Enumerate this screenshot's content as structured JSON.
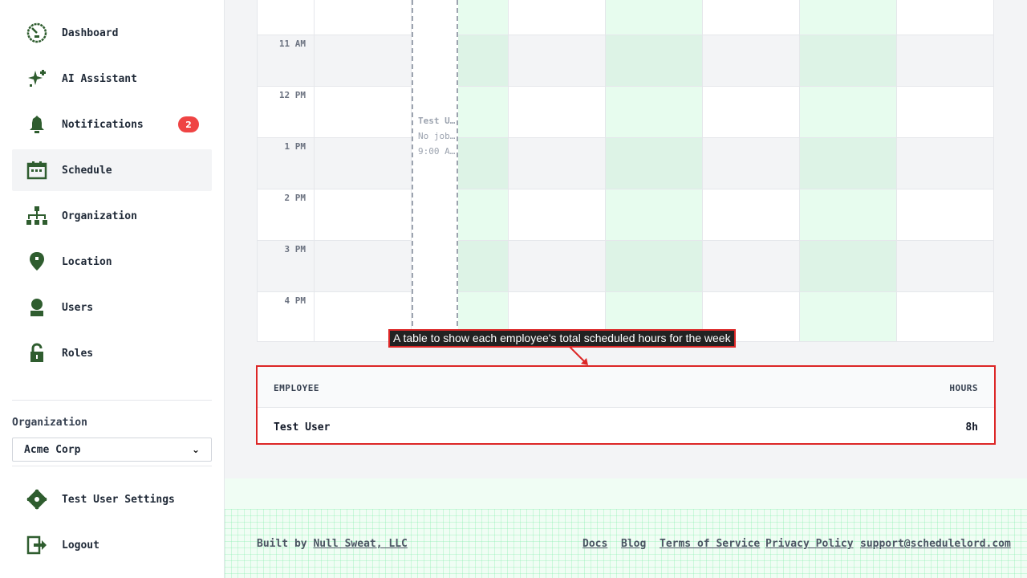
{
  "sidebar": {
    "items": [
      {
        "label": "Dashboard",
        "icon": "dashboard-icon"
      },
      {
        "label": "AI Assistant",
        "icon": "sparkle-icon"
      },
      {
        "label": "Notifications",
        "icon": "bell-icon",
        "badge": "2"
      },
      {
        "label": "Schedule",
        "icon": "calendar-icon",
        "active": true
      },
      {
        "label": "Organization",
        "icon": "org-chart-icon"
      },
      {
        "label": "Location",
        "icon": "location-pin-icon"
      },
      {
        "label": "Users",
        "icon": "user-icon"
      },
      {
        "label": "Roles",
        "icon": "lock-icon"
      }
    ],
    "organization_label": "Organization",
    "organization_selected": "Acme Corp",
    "settings_label": "Test User Settings",
    "logout_label": "Logout"
  },
  "calendar": {
    "time_labels": [
      "11 AM",
      "12 PM",
      "1 PM",
      "2 PM",
      "3 PM",
      "4 PM"
    ],
    "event": {
      "title": "Test U…",
      "subtitle": "No job…",
      "time": "9:00 A…"
    }
  },
  "annotation": {
    "text": "A table to show each employee's total scheduled hours for the week"
  },
  "hours_table": {
    "headers": [
      "EMPLOYEE",
      "HOURS"
    ],
    "rows": [
      {
        "employee": "Test User",
        "hours": "8h"
      }
    ]
  },
  "footer": {
    "built_by_prefix": "Built by",
    "built_by_link": "Null Sweat, LLC",
    "links": [
      "Docs",
      "Blog",
      "Terms of Service",
      "Privacy Policy",
      "support@schedulelord.com"
    ]
  },
  "colors": {
    "icon_green": "#2f5d2f",
    "badge_red": "#ef4444",
    "annotation_red": "#dc2626",
    "today_green": "#dcfce7"
  }
}
